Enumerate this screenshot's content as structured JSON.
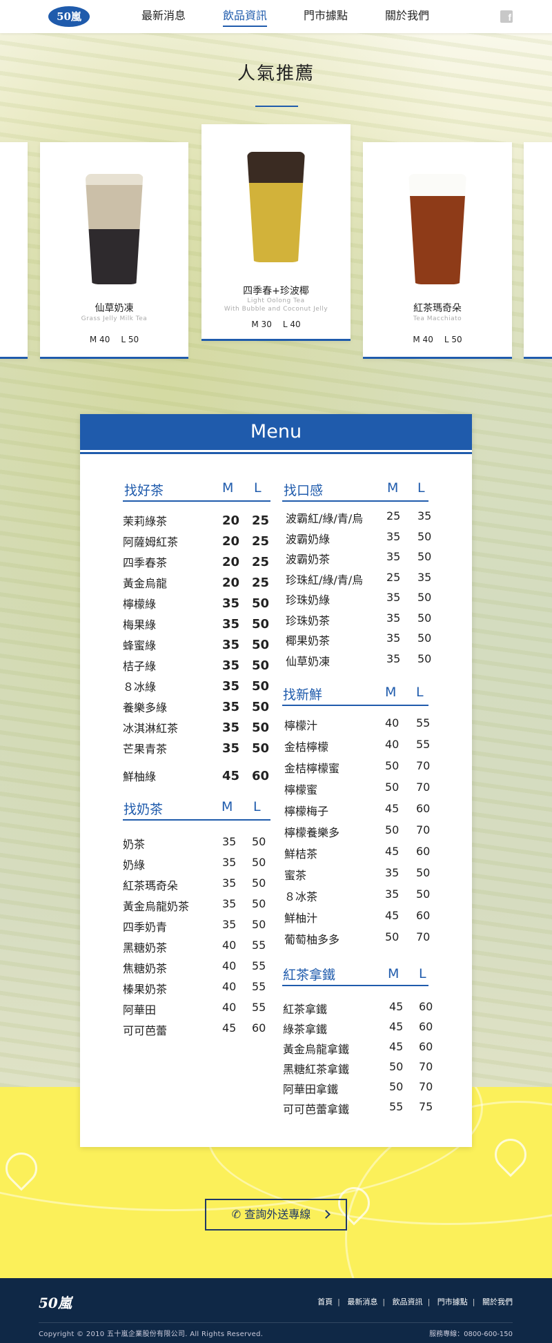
{
  "header": {
    "logo": "50嵐",
    "nav": [
      "最新消息",
      "飲品資訊",
      "門市據點",
      "關於我們"
    ],
    "active_index": 1,
    "social_icon": "facebook-icon"
  },
  "popular": {
    "title": "人氣推薦",
    "cards": [
      {
        "name": "仙草奶凍",
        "en": "Grass Jelly Milk Tea",
        "en2": "",
        "m": "M 40",
        "l": "L 50"
      },
      {
        "name": "四季春+珍波椰",
        "en": "Light Oolong Tea",
        "en2": "With Bubble and Coconut Jelly",
        "m": "M 30",
        "l": "L 40"
      },
      {
        "name": "紅茶瑪奇朵",
        "en": "Tea Macchiato",
        "en2": "",
        "m": "M 40",
        "l": "L 50"
      }
    ]
  },
  "menu": {
    "title": "Menu",
    "col_m": "M",
    "col_l": "L",
    "sections": {
      "good_tea": {
        "title": "找好茶",
        "items": [
          {
            "name": "茉莉綠茶",
            "m": "20",
            "l": "25"
          },
          {
            "name": "阿薩姆紅茶",
            "m": "20",
            "l": "25"
          },
          {
            "name": "四季春茶",
            "m": "20",
            "l": "25"
          },
          {
            "name": "黃金烏龍",
            "m": "20",
            "l": "25"
          },
          {
            "name": "檸檬綠",
            "m": "35",
            "l": "50"
          },
          {
            "name": "梅果綠",
            "m": "35",
            "l": "50"
          },
          {
            "name": "蜂蜜綠",
            "m": "35",
            "l": "50"
          },
          {
            "name": "桔子綠",
            "m": "35",
            "l": "50"
          },
          {
            "name": "８冰綠",
            "m": "35",
            "l": "50"
          },
          {
            "name": "養樂多綠",
            "m": "35",
            "l": "50"
          },
          {
            "name": "冰淇淋紅茶",
            "m": "35",
            "l": "50"
          },
          {
            "name": "芒果青茶",
            "m": "35",
            "l": "50"
          },
          {
            "name": "鮮柚綠",
            "m": "45",
            "l": "60"
          }
        ]
      },
      "milk_tea": {
        "title": "找奶茶",
        "items": [
          {
            "name": "奶茶",
            "m": "35",
            "l": "50"
          },
          {
            "name": "奶綠",
            "m": "35",
            "l": "50"
          },
          {
            "name": "紅茶瑪奇朵",
            "m": "35",
            "l": "50"
          },
          {
            "name": "黃金烏龍奶茶",
            "m": "35",
            "l": "50"
          },
          {
            "name": "四季奶青",
            "m": "35",
            "l": "50"
          },
          {
            "name": "黑糖奶茶",
            "m": "40",
            "l": "55"
          },
          {
            "name": "焦糖奶茶",
            "m": "40",
            "l": "55"
          },
          {
            "name": "榛果奶茶",
            "m": "40",
            "l": "55"
          },
          {
            "name": "阿華田",
            "m": "40",
            "l": "55"
          },
          {
            "name": "可可芭蕾",
            "m": "45",
            "l": "60"
          }
        ]
      },
      "texture": {
        "title": "找口感",
        "items": [
          {
            "name": "波霸紅/綠/青/烏",
            "m": "25",
            "l": "35"
          },
          {
            "name": "波霸奶綠",
            "m": "35",
            "l": "50"
          },
          {
            "name": "波霸奶茶",
            "m": "35",
            "l": "50"
          },
          {
            "name": "珍珠紅/綠/青/烏",
            "m": "25",
            "l": "35"
          },
          {
            "name": "珍珠奶綠",
            "m": "35",
            "l": "50"
          },
          {
            "name": "珍珠奶茶",
            "m": "35",
            "l": "50"
          },
          {
            "name": "椰果奶茶",
            "m": "35",
            "l": "50"
          },
          {
            "name": "仙草奶凍",
            "m": "35",
            "l": "50"
          }
        ]
      },
      "fresh": {
        "title": "找新鮮",
        "items": [
          {
            "name": "檸檬汁",
            "m": "40",
            "l": "55"
          },
          {
            "name": "金桔檸檬",
            "m": "40",
            "l": "55"
          },
          {
            "name": "金桔檸檬蜜",
            "m": "50",
            "l": "70"
          },
          {
            "name": "檸檬蜜",
            "m": "50",
            "l": "70"
          },
          {
            "name": "檸檬梅子",
            "m": "45",
            "l": "60"
          },
          {
            "name": "檸檬養樂多",
            "m": "50",
            "l": "70"
          },
          {
            "name": "鮮桔茶",
            "m": "45",
            "l": "60"
          },
          {
            "name": "蜜茶",
            "m": "35",
            "l": "50"
          },
          {
            "name": "８冰茶",
            "m": "35",
            "l": "50"
          },
          {
            "name": "鮮柚汁",
            "m": "45",
            "l": "60"
          },
          {
            "name": "葡萄柚多多",
            "m": "50",
            "l": "70"
          }
        ]
      },
      "latte": {
        "title": "紅茶拿鐵",
        "items": [
          {
            "name": "紅茶拿鐵",
            "m": "45",
            "l": "60"
          },
          {
            "name": "綠茶拿鐵",
            "m": "45",
            "l": "60"
          },
          {
            "name": "黃金烏龍拿鐵",
            "m": "45",
            "l": "60"
          },
          {
            "name": "黑糖紅茶拿鐵",
            "m": "50",
            "l": "70"
          },
          {
            "name": "阿華田拿鐵",
            "m": "50",
            "l": "70"
          },
          {
            "name": "可可芭蕾拿鐵",
            "m": "55",
            "l": "75"
          }
        ]
      }
    }
  },
  "delivery_button": "查詢外送專線",
  "footer": {
    "logo": "50嵐",
    "links": [
      "首頁",
      "最新消息",
      "飲品資訊",
      "門市據點",
      "關於我們"
    ],
    "copyright": "Copyright © 2010 五十嵐企業股份有限公司. All Rights Reserved.",
    "hotline": "服務專線：0800-600-150"
  }
}
